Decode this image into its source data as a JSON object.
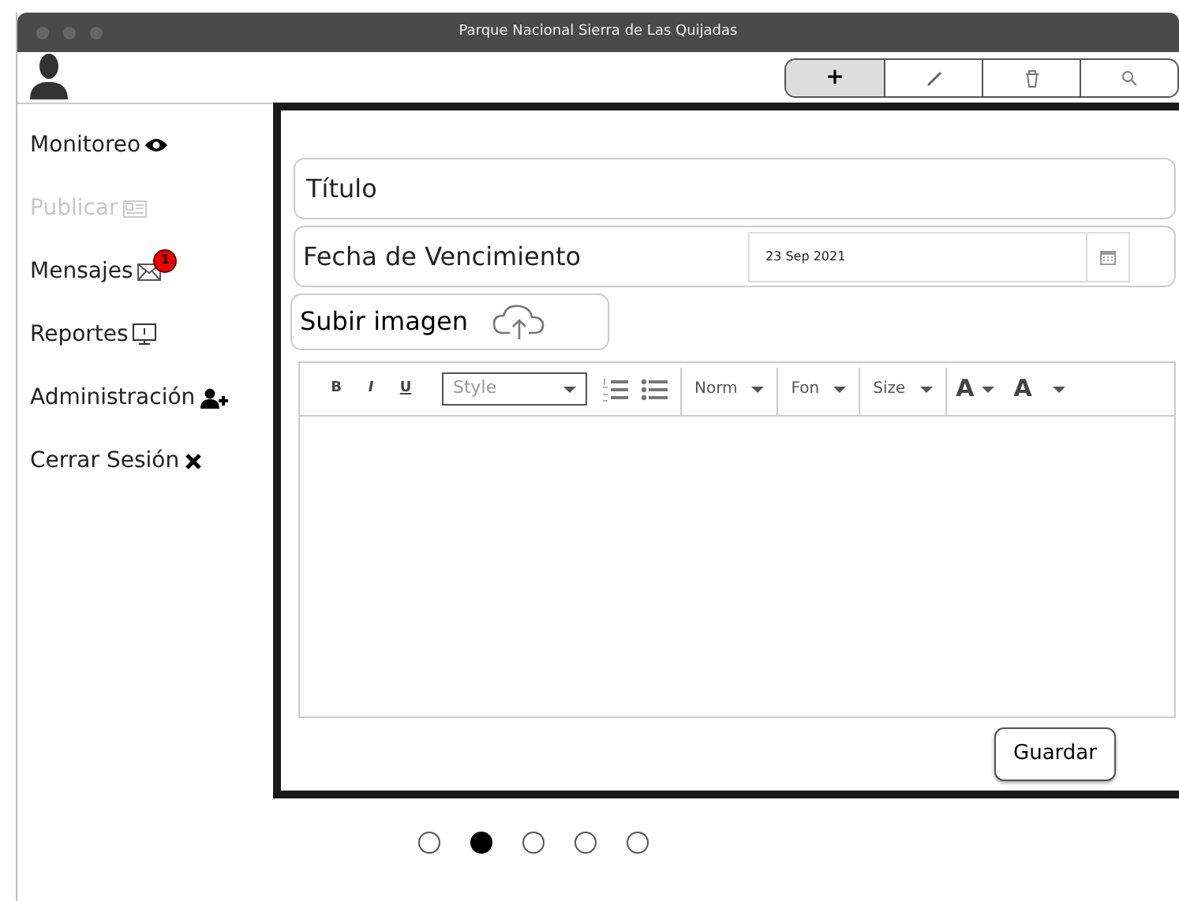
{
  "window": {
    "title": "Parque Nacional Sierra de Las Quijadas"
  },
  "toolbar": [
    {
      "label": "+",
      "selected": true
    },
    {
      "selected": false
    },
    {
      "selected": false
    },
    {
      "selected": false
    }
  ],
  "sidebar": {
    "items": [
      {
        "label": "Monitoreo",
        "disabled": false
      },
      {
        "label": "Publicar",
        "disabled": true
      },
      {
        "label": "Mensajes",
        "disabled": false,
        "badge": "1"
      },
      {
        "label": "Reportes",
        "disabled": false
      },
      {
        "label": "Administración",
        "disabled": false
      },
      {
        "label": "Cerrar Sesión",
        "disabled": false
      }
    ]
  },
  "form": {
    "title_field": {
      "placeholder": "Título"
    },
    "due_date": {
      "label": "Fecha de Vencimiento",
      "value": "23 Sep 2021"
    },
    "upload": {
      "label": "Subir imagen"
    },
    "editor": {
      "format_buttons": [
        "B",
        "I",
        "U"
      ],
      "style_select": {
        "placeholder": "Style"
      },
      "dropdowns": [
        "Norm",
        "Fon",
        "Size"
      ],
      "color_buttons": [
        "A",
        "A"
      ]
    },
    "save_button": "Guardar"
  },
  "pagination": [
    {
      "selected": false
    },
    {
      "selected": true
    },
    {
      "selected": false
    },
    {
      "selected": false
    },
    {
      "selected": false
    }
  ]
}
